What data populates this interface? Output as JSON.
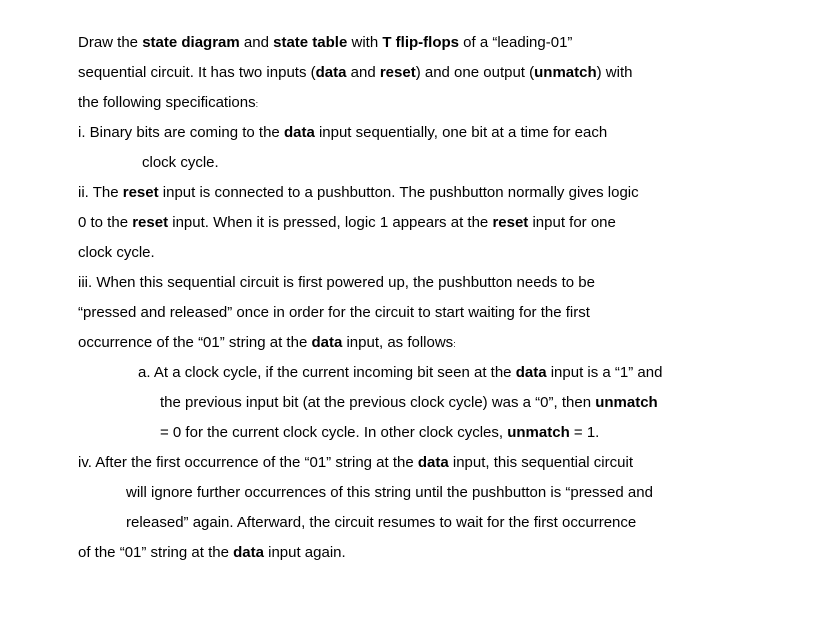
{
  "doc": {
    "p1a": "Draw the ",
    "p1b": "state diagram",
    "p1c": " and ",
    "p1d": "state table",
    "p1e": " with ",
    "p1f": "T flip-flops",
    "p1g": " of a “leading-01”",
    "p2a": "sequential circuit. It has two inputs (",
    "p2b": "data",
    "p2c": " and ",
    "p2d": "reset",
    "p2e": ") and one output (",
    "p2f": "unmatch",
    "p2g": ") with",
    "p3a": "the  following specifications",
    "colon": ":",
    "s1a": " i. Binary bits are coming to the ",
    "s1b": "data",
    "s1c": " input sequentially, one bit at a time for each",
    "s1d": "clock  cycle.",
    "s2a": " ii. The ",
    "s2b": "reset",
    "s2c": " input is connected to a pushbutton. The pushbutton normally gives logic",
    "s2d": "0 to  the ",
    "s2e": "reset",
    "s2f": " input. When it is pressed, logic 1 appears at the ",
    "s2g": "reset",
    "s2h": " input for one",
    "s2i": "clock cycle.",
    "s3a": "  iii. When this sequential circuit is first powered up, the pushbutton needs to be",
    "s3b": "“pressed and  released” once in order for the circuit to start waiting for the first",
    "s3c": "occurrence of the “01”  string at the ",
    "s3d": "data",
    "s3e": " input, as follows",
    "s4a": "a. At a clock cycle, if the current incoming bit seen at the ",
    "s4b": "data",
    "s4c": " input is a “1” and",
    "s4d": "the  previous input bit (at the previous clock cycle) was a “0”, then ",
    "s4e": "unmatch",
    "s4f": "= 0 for the  current clock cycle. In other clock cycles, ",
    "s4g": "unmatch",
    "s4h": " = 1.",
    "s5a": "iv. After the first occurrence of the “01” string at the ",
    "s5b": "data",
    "s5c": " input, this sequential circuit",
    "s5d": "will  ignore further occurrences of this string until the pushbutton is “pressed and",
    "s5e": "released”  again. Afterward, the circuit resumes to wait for the first occurrence",
    "s5f": "of the “01” string  at the ",
    "s5g": "data",
    "s5h": " input again."
  }
}
